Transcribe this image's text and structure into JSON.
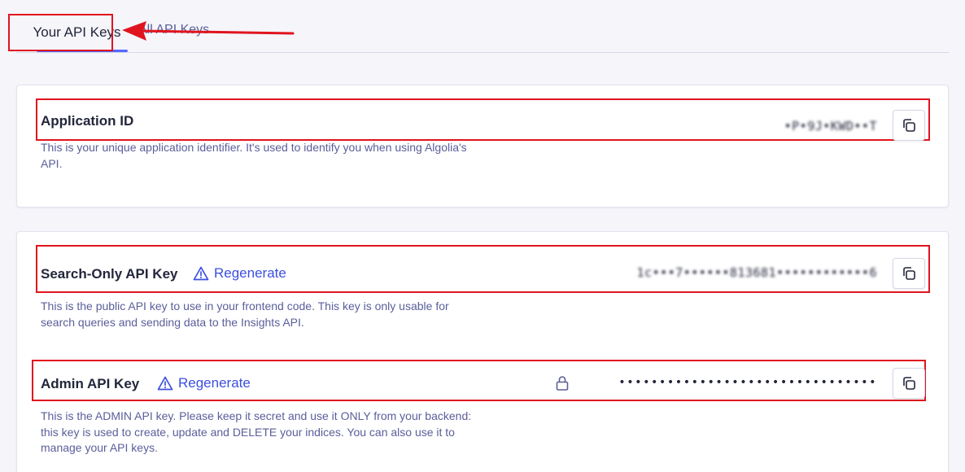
{
  "tabs": {
    "active_label": "Your API Keys",
    "other_label": "All API Keys"
  },
  "application_id": {
    "title": "Application ID",
    "value": "•P•9J•KWD••T",
    "description": "This is your unique application identifier. It's used to identify you when using Algolia's API."
  },
  "search_key": {
    "title": "Search-Only API Key",
    "regenerate_label": "Regenerate",
    "value": "1c•••7••••••813681••••••••••••6",
    "description": "This is the public API key to use in your frontend code. This key is only usable for search queries and sending data to the Insights API."
  },
  "admin_key": {
    "title": "Admin API Key",
    "regenerate_label": "Regenerate",
    "value": "••••••••••••••••••••••••••••••••",
    "description": "This is the ADMIN API key. Please keep it secret and use it ONLY from your backend: this key is used to create, update and DELETE your indices. You can also use it to manage your API keys."
  },
  "colors": {
    "accent": "#5468ff",
    "link": "#3c4fe0",
    "annotation": "#e0141e",
    "text": "#23263b",
    "muted": "#5a5e9a"
  },
  "icons": [
    "copy-icon",
    "warning-icon",
    "lock-icon",
    "arrow-annotation"
  ]
}
